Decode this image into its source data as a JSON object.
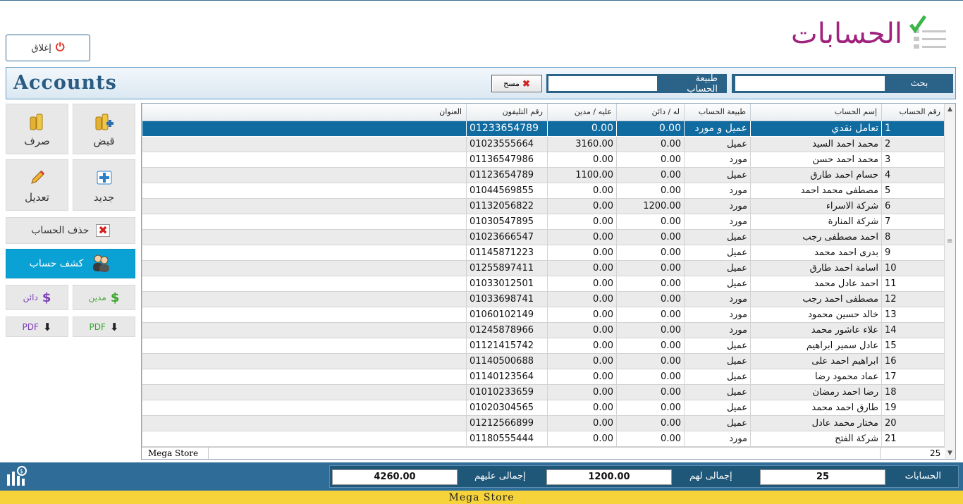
{
  "header": {
    "title_ar": "الحسابات",
    "close_label": "إغلاق",
    "logo_icon": "checklist-icon"
  },
  "searchbar": {
    "title_en": "Accounts",
    "search_label": "بحث",
    "search_value": "",
    "type_label": "طبيعة الحساب",
    "type_value": "",
    "clear_label": "مسح"
  },
  "actions": {
    "receive": "قبض",
    "pay": "صرف",
    "new": "جديد",
    "edit": "تعديل",
    "delete": "حذف الحساب",
    "statement": "كشف حساب",
    "debtor": "مدين",
    "creditor": "دائن",
    "pdf": "PDF",
    "colors": {
      "debtor": "#3aa62c",
      "creditor": "#7b3fb5",
      "statement_bg": "#0aa2d4",
      "accent": "#2b6287"
    }
  },
  "grid": {
    "columns": [
      "رقم الحساب",
      "إسم الحساب",
      "طبيعة الحساب",
      "له / دائن",
      "عليه / مدين",
      "رقم التليفون",
      "العنوان"
    ],
    "rows": [
      {
        "num": "1",
        "name": "تعامل نقدي",
        "type": "عميل و مورد",
        "credit": "0.00",
        "debit": "0.00",
        "phone": "01233654789",
        "address": "",
        "selected": true
      },
      {
        "num": "2",
        "name": "محمد احمد السيد",
        "type": "عميل",
        "credit": "0.00",
        "debit": "3160.00",
        "phone": "01023555664",
        "address": ""
      },
      {
        "num": "3",
        "name": "محمد احمد حسن",
        "type": "مورد",
        "credit": "0.00",
        "debit": "0.00",
        "phone": "01136547986",
        "address": ""
      },
      {
        "num": "4",
        "name": "حسام احمد طارق",
        "type": "عميل",
        "credit": "0.00",
        "debit": "1100.00",
        "phone": "01123654789",
        "address": ""
      },
      {
        "num": "5",
        "name": "مصطفى محمد احمد",
        "type": "مورد",
        "credit": "0.00",
        "debit": "0.00",
        "phone": "01044569855",
        "address": ""
      },
      {
        "num": "6",
        "name": "شركة الاسراء",
        "type": "مورد",
        "credit": "1200.00",
        "debit": "0.00",
        "phone": "01132056822",
        "address": ""
      },
      {
        "num": "7",
        "name": "شركة المنارة",
        "type": "مورد",
        "credit": "0.00",
        "debit": "0.00",
        "phone": "01030547895",
        "address": ""
      },
      {
        "num": "8",
        "name": "احمد مصطفى رجب",
        "type": "عميل",
        "credit": "0.00",
        "debit": "0.00",
        "phone": "01023666547",
        "address": ""
      },
      {
        "num": "9",
        "name": "بدرى احمد محمد",
        "type": "عميل",
        "credit": "0.00",
        "debit": "0.00",
        "phone": "01145871223",
        "address": ""
      },
      {
        "num": "10",
        "name": "اسامة احمد طارق",
        "type": "عميل",
        "credit": "0.00",
        "debit": "0.00",
        "phone": "01255897411",
        "address": ""
      },
      {
        "num": "11",
        "name": "احمد عادل محمد",
        "type": "عميل",
        "credit": "0.00",
        "debit": "0.00",
        "phone": "01033012501",
        "address": ""
      },
      {
        "num": "12",
        "name": "مصطفى احمد رجب",
        "type": "مورد",
        "credit": "0.00",
        "debit": "0.00",
        "phone": "01033698741",
        "address": ""
      },
      {
        "num": "13",
        "name": "خالد حسين محمود",
        "type": "مورد",
        "credit": "0.00",
        "debit": "0.00",
        "phone": "01060102149",
        "address": ""
      },
      {
        "num": "14",
        "name": "علاء عاشور محمد",
        "type": "مورد",
        "credit": "0.00",
        "debit": "0.00",
        "phone": "01245878966",
        "address": ""
      },
      {
        "num": "15",
        "name": "عادل سمير ابراهيم",
        "type": "عميل",
        "credit": "0.00",
        "debit": "0.00",
        "phone": "01121415742",
        "address": ""
      },
      {
        "num": "16",
        "name": "ابراهيم احمد على",
        "type": "عميل",
        "credit": "0.00",
        "debit": "0.00",
        "phone": "01140500688",
        "address": ""
      },
      {
        "num": "17",
        "name": "عماد محمود رضا",
        "type": "عميل",
        "credit": "0.00",
        "debit": "0.00",
        "phone": "01140123564",
        "address": ""
      },
      {
        "num": "18",
        "name": "رضا احمد رمضان",
        "type": "عميل",
        "credit": "0.00",
        "debit": "0.00",
        "phone": "01010233659",
        "address": ""
      },
      {
        "num": "19",
        "name": "طارق احمد محمد",
        "type": "عميل",
        "credit": "0.00",
        "debit": "0.00",
        "phone": "01020304565",
        "address": ""
      },
      {
        "num": "20",
        "name": "مختار محمد عادل",
        "type": "عميل",
        "credit": "0.00",
        "debit": "0.00",
        "phone": "01212566899",
        "address": ""
      },
      {
        "num": "21",
        "name": "شركة الفتح",
        "type": "مورد",
        "credit": "0.00",
        "debit": "0.00",
        "phone": "01180555444",
        "address": ""
      }
    ],
    "footer_store": "Mega Store",
    "footer_count": "25"
  },
  "totals": {
    "accounts_label": "الحسابات",
    "accounts_value": "25",
    "credit_label": "إجمالى لهم",
    "credit_value": "1200.00",
    "debit_label": "إجمالى عليهم",
    "debit_value": "4260.00"
  },
  "status": {
    "store": "Mega Store"
  }
}
